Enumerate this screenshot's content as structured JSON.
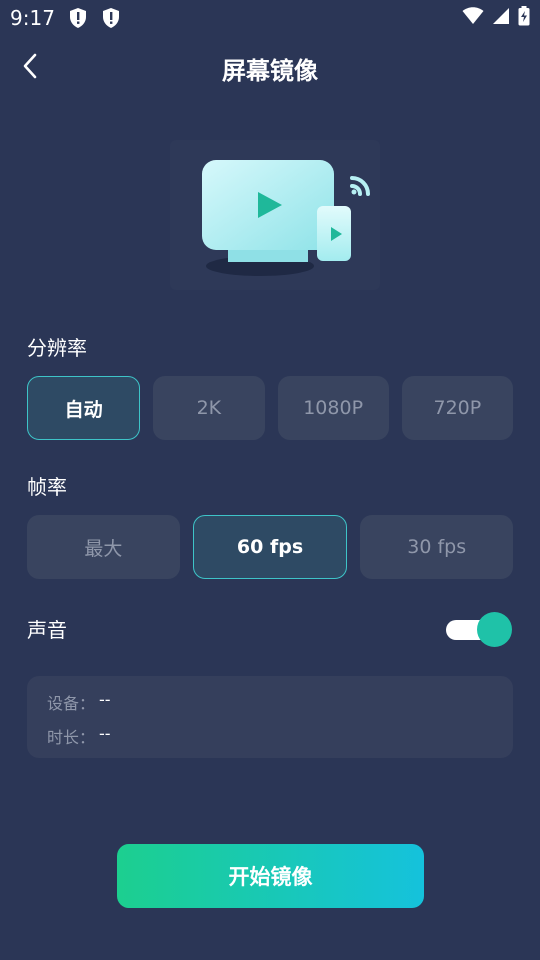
{
  "status_bar": {
    "time": "9:17"
  },
  "header": {
    "title": "屏幕镜像",
    "back_icon": "chevron-left-icon"
  },
  "resolution": {
    "label": "分辨率",
    "options": [
      "自动",
      "2K",
      "1080P",
      "720P"
    ],
    "selected": "自动"
  },
  "framerate": {
    "label": "帧率",
    "options": [
      "最大",
      "60 fps",
      "30 fps"
    ],
    "selected": "60 fps"
  },
  "sound": {
    "label": "声音",
    "enabled": true
  },
  "info": {
    "device_label": "设备：",
    "device_value": "--",
    "duration_label": "时长：",
    "duration_value": "--"
  },
  "start_button": {
    "label": "开始镜像"
  },
  "colors": {
    "background": "#2b3656",
    "accent": "#1fc2a8",
    "active_border": "#3ec4c8",
    "button_gradient_start": "#1ccf8f",
    "button_gradient_end": "#15c2dc"
  }
}
